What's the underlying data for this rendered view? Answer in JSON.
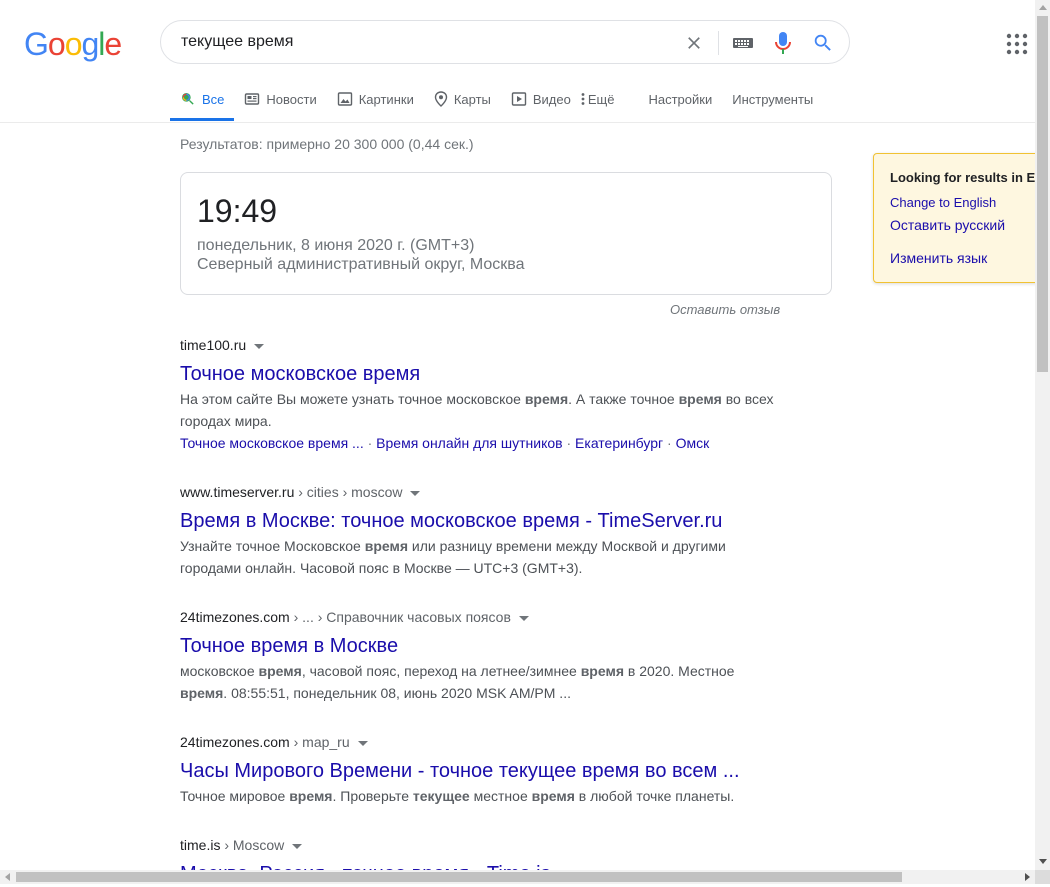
{
  "logo": {
    "letters": [
      "G",
      "o",
      "o",
      "g",
      "l",
      "e"
    ],
    "colors": [
      "#4285f4",
      "#ea4335",
      "#fbbc05",
      "#4285f4",
      "#34a853",
      "#ea4335"
    ]
  },
  "search": {
    "query": "текущее время"
  },
  "tabs": [
    {
      "label": "Все",
      "icon": "search-icon",
      "active": true
    },
    {
      "label": "Новости",
      "icon": "news-icon"
    },
    {
      "label": "Картинки",
      "icon": "image-icon"
    },
    {
      "label": "Карты",
      "icon": "map-pin-icon"
    },
    {
      "label": "Видео",
      "icon": "video-icon"
    },
    {
      "label": "Ещё",
      "icon": "more-vert-icon"
    },
    {
      "label": "Настройки"
    },
    {
      "label": "Инструменты"
    }
  ],
  "stats": "Результатов: примерно 20 300 000 (0,44 сек.)",
  "time_card": {
    "time": "19:49",
    "date": "понедельник, 8 июня 2020 г. (GMT+3)",
    "location": "Северный административный округ, Москва",
    "feedback": "Оставить отзыв"
  },
  "results": [
    {
      "domain": "time100.ru",
      "path": "",
      "title": "Точное московское время",
      "snippet_html": "На этом сайте Вы можете узнать точное московское <b>время</b>. А также точное <b>время</b> во всех городах мира.",
      "sitelinks": [
        "Точное московское время ...",
        "Время онлайн для шутников",
        "Екатеринбург",
        "Омск"
      ]
    },
    {
      "domain": "www.timeserver.ru",
      "path": " › cities › moscow",
      "title": "Время в Москве: точное московское время - TimeServer.ru",
      "snippet_html": "Узнайте точное Московское <b>время</b> или разницу времени между Москвой и другими городами онлайн. Часовой пояс в Москве — UTC+3 (GMT+3)."
    },
    {
      "domain": "24timezones.com",
      "path": " › ... › Справочник часовых поясов",
      "title": "Точное время в Москве",
      "snippet_html": "московское <b>время</b>, часовой пояс, переход на летнее/зимнее <b>время</b> в 2020. Местное <b>время</b>. 08:55:51, понедельник 08, июнь 2020 MSK AM/PM ..."
    },
    {
      "domain": "24timezones.com",
      "path": " › map_ru",
      "title": "Часы Мирового Времени - точное текущее время во всем ...",
      "snippet_html": "Точное мировое <b>время</b>. Проверьте <b>текущее</b> местное <b>время</b> в любой точке планеты."
    },
    {
      "domain": "time.is",
      "path": " › Moscow",
      "title": "Москва, Россия - точное время - Time.is",
      "snippet_html": ""
    }
  ],
  "language_panel": {
    "title": "Looking for results in E",
    "change": "Change to English",
    "keep": "Оставить русский",
    "change_lang": "Изменить язык"
  }
}
